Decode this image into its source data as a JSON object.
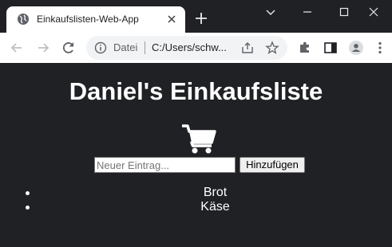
{
  "browser": {
    "tab": {
      "title": "Einkaufslisten-Web-App"
    },
    "omnibox": {
      "chip": "Datei",
      "url": "C:/Users/schw..."
    }
  },
  "page": {
    "title": "Daniel's Einkaufsliste",
    "input_placeholder": "Neuer Eintrag...",
    "add_button_label": "Hinzufügen",
    "items": [
      {
        "label": "Brot"
      },
      {
        "label": "Käse"
      }
    ]
  }
}
